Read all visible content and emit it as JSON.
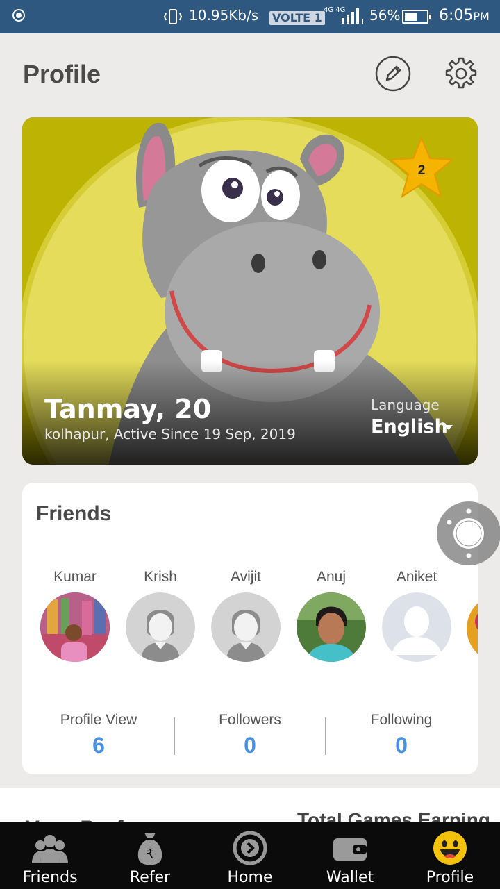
{
  "status_bar": {
    "speed": "10.95Kb/s",
    "volte": "VOLTE 1",
    "network": "4G 4G",
    "battery": "56%",
    "battery_level": 0.56,
    "time": "6:05",
    "time_suffix": "PM"
  },
  "header": {
    "title": "Profile",
    "edit_icon": "pencil-icon",
    "settings_icon": "gear-icon"
  },
  "profile": {
    "name_age": "Tanmay, 20",
    "meta": "kolhapur, Active Since 19 Sep, 2019",
    "language_label": "Language",
    "language_value": "English",
    "level": "2"
  },
  "friends": {
    "title": "Friends",
    "items": [
      {
        "name": "Kumar",
        "avatar": "photo"
      },
      {
        "name": "Krish",
        "avatar": "placeholder"
      },
      {
        "name": "Avijit",
        "avatar": "placeholder"
      },
      {
        "name": "Anuj",
        "avatar": "photo"
      },
      {
        "name": "Aniket",
        "avatar": "silhouette"
      }
    ]
  },
  "stats": [
    {
      "label": "Profile View",
      "value": "6"
    },
    {
      "label": "Followers",
      "value": "0"
    },
    {
      "label": "Following",
      "value": "0"
    }
  ],
  "next_section": {
    "left_title": "Your Preferences",
    "right_title": "Total Games Earning"
  },
  "bottom_nav": [
    {
      "label": "Friends",
      "icon": "friends-icon"
    },
    {
      "label": "Refer",
      "icon": "money-bag-icon"
    },
    {
      "label": "Home",
      "icon": "home-icon"
    },
    {
      "label": "Wallet",
      "icon": "wallet-icon"
    },
    {
      "label": "Profile",
      "icon": "smiley-icon"
    }
  ],
  "colors": {
    "status_bar": "#2e5880",
    "accent_blue": "#4a90e2",
    "star": "#f4b400",
    "hero_yellow": "#e4dc5a",
    "nav_bg": "#0b0b0b"
  }
}
